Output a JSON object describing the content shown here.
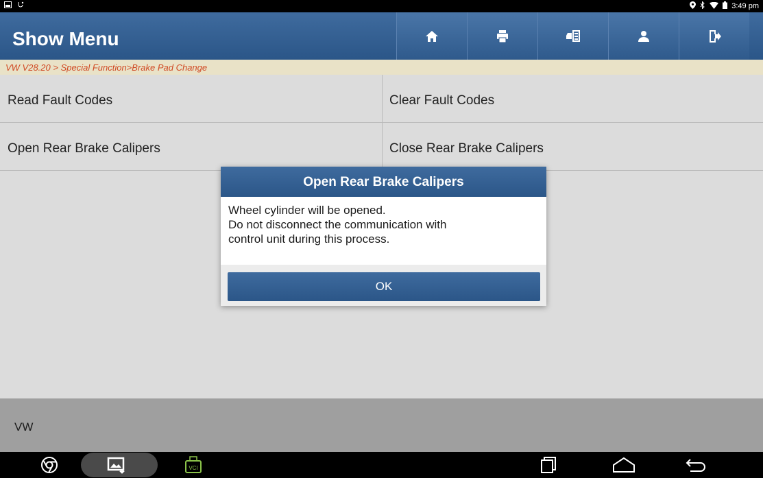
{
  "status_bar": {
    "time": "3:49 pm"
  },
  "header": {
    "title": "Show Menu",
    "toolbar": [
      "home-icon",
      "print-icon",
      "car-report-icon",
      "user-icon",
      "exit-icon"
    ]
  },
  "breadcrumb": "VW V28.20 > Special Function>Brake Pad Change",
  "menu": [
    {
      "label": "Read Fault Codes"
    },
    {
      "label": "Clear Fault Codes"
    },
    {
      "label": "Open Rear Brake Calipers"
    },
    {
      "label": "Close Rear Brake Calipers"
    }
  ],
  "footer": {
    "brand": "VW"
  },
  "dialog": {
    "title": "Open Rear Brake Calipers",
    "line1": "Wheel cylinder will be opened.",
    "line2": "Do not disconnect the communication with",
    "line3": "control unit during this process.",
    "ok_label": "OK"
  },
  "navbar": {
    "vci_label": "VCI"
  },
  "colors": {
    "header_blue": "#2b5688",
    "breadcrumb_text": "#d04a24",
    "breadcrumb_bg": "#e9e2c7"
  }
}
